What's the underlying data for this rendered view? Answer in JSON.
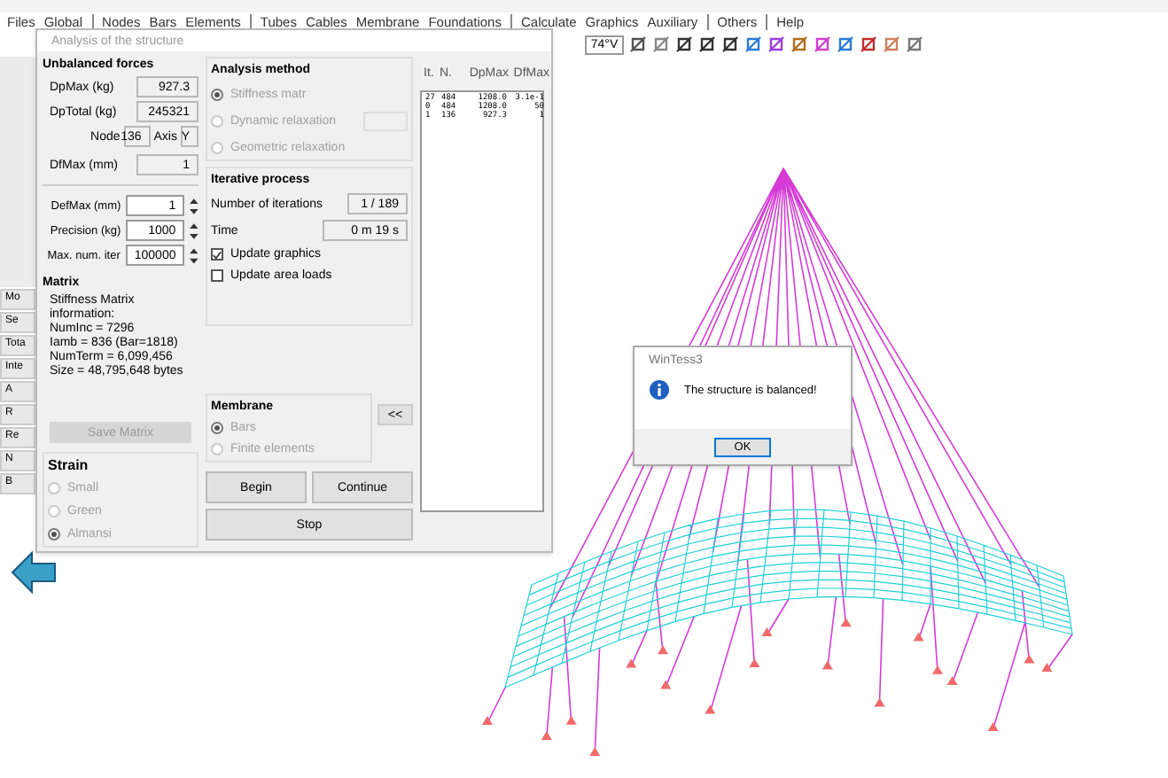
{
  "menu": [
    {
      "label": "Files",
      "separator_after": false
    },
    {
      "label": "Global",
      "separator_after": true
    },
    {
      "label": "Nodes",
      "separator_after": false
    },
    {
      "label": "Bars",
      "separator_after": false
    },
    {
      "label": "Elements",
      "separator_after": true
    },
    {
      "label": "Tubes",
      "separator_after": false
    },
    {
      "label": "Cables",
      "separator_after": false
    },
    {
      "label": "Membrane",
      "separator_after": false
    },
    {
      "label": "Foundations",
      "separator_after": true
    },
    {
      "label": "Calculate",
      "separator_after": false
    },
    {
      "label": "Graphics",
      "separator_after": false
    },
    {
      "label": "Auxiliary",
      "separator_after": true
    },
    {
      "label": "Others",
      "separator_after": true
    },
    {
      "label": "Help",
      "separator_after": false
    }
  ],
  "toolbar": {
    "angle_field": "74°V"
  },
  "left_strip": [
    "Mo",
    "Se",
    "Tota",
    "Inte",
    "A",
    "R",
    "Re",
    "N",
    "B"
  ],
  "dialog": {
    "title": "Analysis of the structure",
    "unbalanced_forces": {
      "title": "Unbalanced forces",
      "dpmax_label": "DpMax (kg)",
      "dpmax": "927.3",
      "dptotal_label": "DpTotal (kg)",
      "dptotal": "245321",
      "node_label": "Node",
      "node": "136",
      "axis_label": "Axis",
      "axis": "Y",
      "dfmax_label": "DfMax (mm)",
      "dfmax": "1"
    },
    "settings": [
      {
        "label": "DefMax (mm)",
        "value": "1"
      },
      {
        "label": "Precision (kg)",
        "value": "1000"
      },
      {
        "label": "Max. num. iter",
        "value": "100000"
      }
    ],
    "matrix": {
      "title": "Matrix",
      "lines": [
        "Stiffness Matrix",
        "information:",
        "NumInc = 7296",
        "Iamb = 836  (Bar=1818)",
        "NumTerm = 6,099,456",
        "Size = 48,795,648 bytes"
      ]
    },
    "save_button": {
      "label": "Save Matrix",
      "disabled": true
    },
    "strain": {
      "title": "Strain",
      "options": [
        {
          "label": "Small",
          "selected": false,
          "disabled": true
        },
        {
          "label": "Green",
          "selected": false,
          "disabled": true
        },
        {
          "label": "Almansi",
          "selected": true,
          "disabled": true
        }
      ]
    },
    "analysis_method": {
      "title": "Analysis method",
      "options": [
        {
          "label": "Stiffness matr",
          "selected": true,
          "disabled": true
        },
        {
          "label": "Dynamic relaxation",
          "selected": false,
          "disabled": true
        },
        {
          "label": "Geometric relaxation",
          "selected": false,
          "disabled": true
        }
      ]
    },
    "iterative_process": {
      "title": "Iterative process",
      "iterations_label": "Number of iterations",
      "iterations": "1 / 189",
      "time_label": "Time",
      "time": "0 m  19 s",
      "checks": [
        {
          "label": "Update graphics",
          "checked": true
        },
        {
          "label": "Update area loads",
          "checked": false
        }
      ]
    },
    "membrane": {
      "title": "Membrane",
      "options": [
        {
          "label": "Bars",
          "selected": true,
          "disabled": true
        },
        {
          "label": "Finite elements",
          "selected": false,
          "disabled": true
        }
      ]
    },
    "collapse_button": "<<",
    "buttons": [
      "Begin",
      "Continue",
      "Stop"
    ],
    "log": {
      "columns": [
        "It.",
        "N.",
        "DpMax",
        "DfMax"
      ],
      "rows": [
        [
          "27",
          "484",
          "1208.0",
          "3.1e-1"
        ],
        [
          "0",
          "484",
          "1208.0",
          "50"
        ],
        [
          "1",
          "136",
          "927.3",
          "1"
        ]
      ]
    }
  },
  "message_box": {
    "title": "WinTess3",
    "text": "The structure is balanced!",
    "button": "OK"
  }
}
